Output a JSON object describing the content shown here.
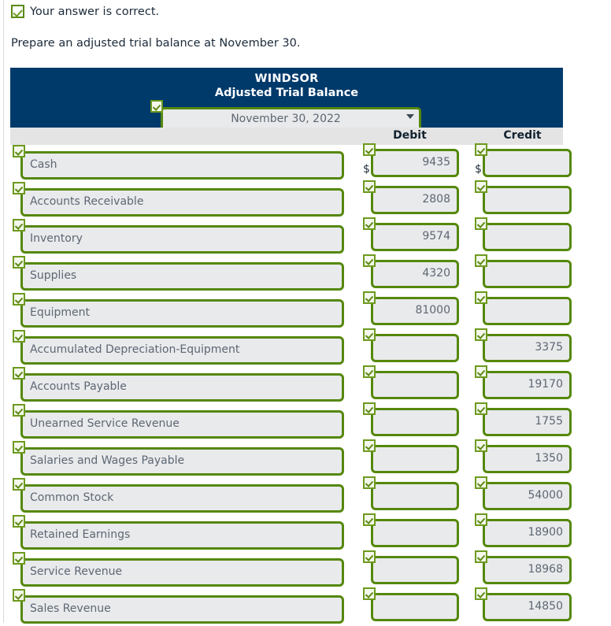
{
  "feedback": {
    "icon": "checkmark-icon",
    "text": "Your answer is correct."
  },
  "instruction": "Prepare an adjusted trial balance at November 30.",
  "table": {
    "company": "WINDSOR",
    "report_title": "Adjusted Trial Balance",
    "date_select": {
      "value": "November 30, 2022",
      "caret": "chevron-down-icon"
    },
    "columns": {
      "debit": "Debit",
      "credit": "Credit"
    },
    "currency_symbol": "$",
    "rows": [
      {
        "account": "Cash",
        "debit": "9435",
        "credit": ""
      },
      {
        "account": "Accounts Receivable",
        "debit": "2808",
        "credit": ""
      },
      {
        "account": "Inventory",
        "debit": "9574",
        "credit": ""
      },
      {
        "account": "Supplies",
        "debit": "4320",
        "credit": ""
      },
      {
        "account": "Equipment",
        "debit": "81000",
        "credit": ""
      },
      {
        "account": "Accumulated Depreciation-Equipment",
        "debit": "",
        "credit": "3375"
      },
      {
        "account": "Accounts Payable",
        "debit": "",
        "credit": "19170"
      },
      {
        "account": "Unearned Service Revenue",
        "debit": "",
        "credit": "1755"
      },
      {
        "account": "Salaries and Wages Payable",
        "debit": "",
        "credit": "1350"
      },
      {
        "account": "Common Stock",
        "debit": "",
        "credit": "54000"
      },
      {
        "account": "Retained Earnings",
        "debit": "",
        "credit": "18900"
      },
      {
        "account": "Service Revenue",
        "debit": "",
        "credit": "18968"
      },
      {
        "account": "Sales Revenue",
        "debit": "",
        "credit": "14850"
      }
    ]
  },
  "colors": {
    "header_navy": "#003a6b",
    "validated_green": "#55880c",
    "field_fill": "#e9eaec",
    "column_head_gray": "#e4e4e4"
  }
}
